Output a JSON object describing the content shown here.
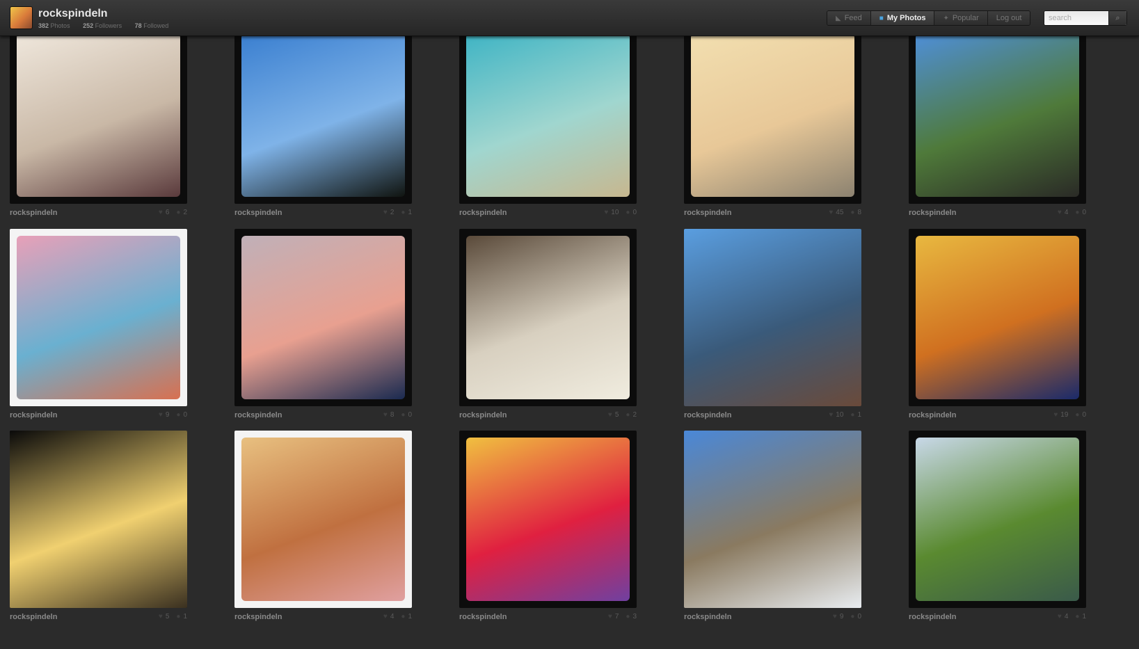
{
  "header": {
    "username": "rockspindeln",
    "stats": [
      {
        "value": "382",
        "label": "Photos"
      },
      {
        "value": "252",
        "label": "Followers"
      },
      {
        "value": "78",
        "label": "Followed"
      }
    ],
    "nav": [
      {
        "label": "Feed",
        "icon": "rss-icon",
        "active": false
      },
      {
        "label": "My Photos",
        "icon": "camera-icon",
        "active": true
      },
      {
        "label": "Popular",
        "icon": "star-icon",
        "active": false
      },
      {
        "label": "Log out",
        "icon": "",
        "active": false
      }
    ],
    "search_placeholder": "search",
    "search_icon": "magnifier-icon"
  },
  "photos": [
    {
      "owner": "rockspindeln",
      "likes": "6",
      "comments": "2",
      "frame": "dark",
      "colors": [
        "#efe7dc",
        "#c9b8a6",
        "#5a3a3c"
      ]
    },
    {
      "owner": "rockspindeln",
      "likes": "2",
      "comments": "1",
      "frame": "dark",
      "colors": [
        "#3a7fd0",
        "#7fb3e8",
        "#101410"
      ]
    },
    {
      "owner": "rockspindeln",
      "likes": "10",
      "comments": "0",
      "frame": "dark",
      "colors": [
        "#3fb4c4",
        "#a0d6cf",
        "#c7b78f"
      ]
    },
    {
      "owner": "rockspindeln",
      "likes": "45",
      "comments": "8",
      "frame": "dark",
      "colors": [
        "#f2dfb0",
        "#e8c898",
        "#8c8270"
      ]
    },
    {
      "owner": "rockspindeln",
      "likes": "4",
      "comments": "0",
      "frame": "dark",
      "colors": [
        "#4f8fd8",
        "#4f7a3a",
        "#2a2a26"
      ]
    },
    {
      "owner": "rockspindeln",
      "likes": "9",
      "comments": "0",
      "frame": "light",
      "colors": [
        "#e8a0b8",
        "#6ab0d0",
        "#d87050"
      ]
    },
    {
      "owner": "rockspindeln",
      "likes": "8",
      "comments": "0",
      "frame": "dark",
      "colors": [
        "#c0b0b8",
        "#e8a090",
        "#1a2a50"
      ]
    },
    {
      "owner": "rockspindeln",
      "likes": "5",
      "comments": "2",
      "frame": "dark",
      "colors": [
        "#5a4a3a",
        "#d8d0c0",
        "#f0ecdf"
      ]
    },
    {
      "owner": "rockspindeln",
      "likes": "10",
      "comments": "1",
      "frame": "none",
      "colors": [
        "#5a9ee0",
        "#3a5a7a",
        "#6a4a3a"
      ]
    },
    {
      "owner": "rockspindeln",
      "likes": "19",
      "comments": "0",
      "frame": "dark",
      "colors": [
        "#e8b840",
        "#d07020",
        "#1a2a6a"
      ]
    },
    {
      "owner": "rockspindeln",
      "likes": "5",
      "comments": "1",
      "frame": "none",
      "colors": [
        "#0a0a0a",
        "#f0d070",
        "#3a3020"
      ]
    },
    {
      "owner": "rockspindeln",
      "likes": "4",
      "comments": "1",
      "frame": "light",
      "colors": [
        "#e8c080",
        "#c07040",
        "#e0a0a0"
      ]
    },
    {
      "owner": "rockspindeln",
      "likes": "7",
      "comments": "3",
      "frame": "dark",
      "colors": [
        "#f0c040",
        "#e02040",
        "#7040a0"
      ]
    },
    {
      "owner": "rockspindeln",
      "likes": "9",
      "comments": "0",
      "frame": "none",
      "colors": [
        "#4a88d8",
        "#8a7a60",
        "#e8ecf0"
      ]
    },
    {
      "owner": "rockspindeln",
      "likes": "4",
      "comments": "1",
      "frame": "dark",
      "colors": [
        "#c8d8e8",
        "#5a8a30",
        "#3a5a4a"
      ]
    }
  ]
}
